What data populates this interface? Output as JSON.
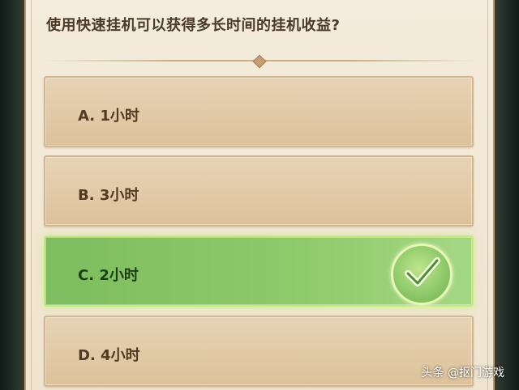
{
  "quiz": {
    "question": "使用快速挂机可以获得多长时间的挂机收益?",
    "options": [
      {
        "text": "A. 1小时",
        "state": "normal"
      },
      {
        "text": "B. 3小时",
        "state": "normal"
      },
      {
        "text": "C. 2小时",
        "state": "correct"
      },
      {
        "text": "D. 4小时",
        "state": "normal"
      }
    ],
    "correct_index": 2
  },
  "icons": {
    "correct_indicator": "checkmark-circle-icon"
  },
  "colors": {
    "panel_bg": "#efe4cf",
    "option_bg": "#dcc29b",
    "correct_bg": "#8fca6b",
    "question_text": "#4a3a28"
  },
  "watermark": "头条 @抠门游戏"
}
